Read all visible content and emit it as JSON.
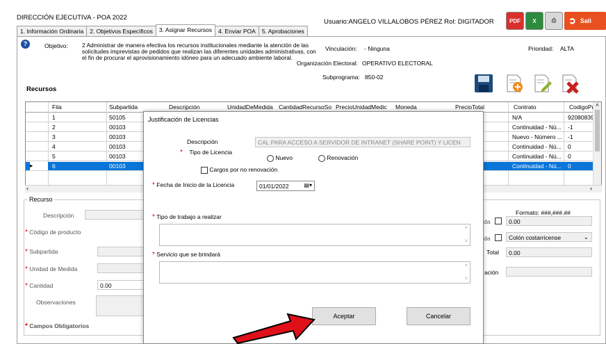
{
  "header": {
    "title": "DIRECCIÓN EJECUTIVA - POA 2022",
    "user_info": "Usuario:ANGELO VILLALOBOS PÉREZ  Rol: DIGITADOR",
    "exit_label": "Sali"
  },
  "tabs": [
    {
      "label": "1. Información Ordinaria"
    },
    {
      "label": "2. Objetivos Específicos"
    },
    {
      "label": "3. Asignar Recursos"
    },
    {
      "label": "4. Enviar POA"
    },
    {
      "label": "5. Aprobaciones"
    }
  ],
  "objective": {
    "label": "Objetivo:",
    "text": "2 Administrar de manera efectiva los recursos institucionales mediante la atención de las solicitudes imprevistas de pedidos que realizan las diferentes unidades administrativas, con el fin de procurar el aprovisionamiento idóneo para un adecuado ambiente laboral.",
    "vinculacion_label": "Vinculación:",
    "vinculacion_value": "- Ninguna",
    "org_label": "Organización Electoral:",
    "org_value": "OPERATIVO ELECTORAL",
    "subprograma_label": "Subprograma:",
    "subprograma_value": "850-02",
    "prioridad_label": "Prioridad:",
    "prioridad_value": "ALTA"
  },
  "section_title": "Recursos",
  "grid": {
    "headers": [
      "Fila",
      "Subpartida",
      "Descripción",
      "UnidadDeMedida",
      "CantidadRecursoSo",
      "PrecioUnidadMedic",
      "Moneda",
      "PrecioTotal",
      "Contrato",
      "CodigoPro"
    ],
    "rows": [
      {
        "fila": "1",
        "subpartida": "50105",
        "contrato": "N/A",
        "codigo": "92080839"
      },
      {
        "fila": "2",
        "subpartida": "00103",
        "contrato": "Continuidad - Nú...",
        "codigo": "-1"
      },
      {
        "fila": "3",
        "subpartida": "00103",
        "contrato": "Nuevo - Número ...",
        "codigo": "-1"
      },
      {
        "fila": "4",
        "subpartida": "00103",
        "contrato": "Continuidad - Nú...",
        "codigo": "0"
      },
      {
        "fila": "5",
        "subpartida": "00103",
        "contrato": "Continuidad - Nú...",
        "codigo": "0"
      },
      {
        "fila": "6",
        "subpartida": "00103",
        "contrato": "Continuidad - Nú...",
        "codigo": "0",
        "selected": true
      }
    ]
  },
  "recurso": {
    "legend": "Recurso",
    "descripcion_label": "Descripción",
    "codigo_label": "Código de producto",
    "subpartida_label": "Subpartida",
    "unidad_label": "Unidad de Medida",
    "cantidad_label": "Cantidad",
    "cantidad_value": "0.00",
    "observaciones_label": "Observaciones",
    "campos_label": "Campos Obligatorios",
    "formato_label": "Formato: ###,###.##",
    "r_field1_label": "da",
    "r_field1_value": "0.00",
    "r_field2_label": "da",
    "r_field2_value": "Colón costarricense",
    "total_label": "Total",
    "total_value": "0.00",
    "acion_label": "ación"
  },
  "dialog": {
    "title": "Justificación de Licencias",
    "descripcion_label": "Descripción",
    "descripcion_value": "CAL PARA ACCESO A SERVIDOR DE INTRANET (SHARE POINT) Y LICEN",
    "tipo_label": "Tipo de Licencia",
    "nuevo_label": "Nuevo",
    "renovacion_label": "Renovación",
    "cargos_label": "Cargos por no renovación",
    "fecha_label": "Fecha de Inicio de la Licencia",
    "fecha_value": "01/01/2022",
    "trabajo_label": "Tipo de trabajo a realizar",
    "servicio_label": "Servicio que se brindará",
    "aceptar_label": "Aceptar",
    "cancelar_label": "Cancelar"
  },
  "colors": {
    "selected_row": "#0a75d8",
    "exit_button": "#e8501f",
    "arrow": "#e0101a",
    "required_star": "#dd0000"
  }
}
